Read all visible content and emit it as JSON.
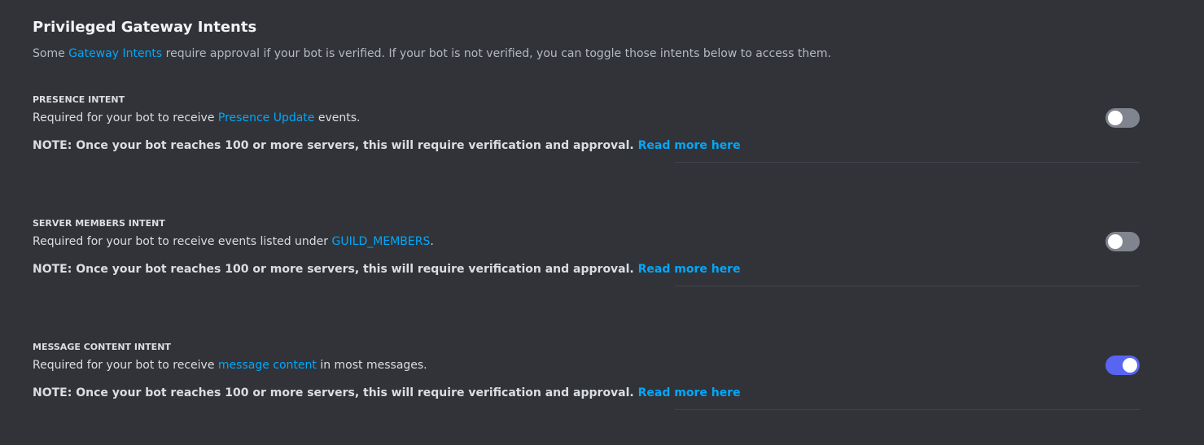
{
  "section": {
    "title": "Privileged Gateway Intents",
    "desc_pre": "Some ",
    "desc_link": "Gateway Intents",
    "desc_post": " require approval if your bot is verified. If your bot is not verified, you can toggle those intents below to access them."
  },
  "intents": [
    {
      "label": "PRESENCE INTENT",
      "desc_pre": "Required for your bot to receive ",
      "desc_link": "Presence Update",
      "desc_post": " events.",
      "note": "NOTE: Once your bot reaches 100 or more servers, this will require verification and approval.",
      "note_link": "Read more here",
      "enabled": false
    },
    {
      "label": "SERVER MEMBERS INTENT",
      "desc_pre": "Required for your bot to receive events listed under ",
      "desc_link": "GUILD_MEMBERS",
      "desc_post": ".",
      "note": "NOTE: Once your bot reaches 100 or more servers, this will require verification and approval.",
      "note_link": "Read more here",
      "enabled": false
    },
    {
      "label": "MESSAGE CONTENT INTENT",
      "desc_pre": "Required for your bot to receive ",
      "desc_link": "message content",
      "desc_post": " in most messages.",
      "note": "NOTE: Once your bot reaches 100 or more servers, this will require verification and approval.",
      "note_link": "Read more here",
      "enabled": true
    }
  ],
  "colors": {
    "background": "#313338",
    "link": "#00a8fc",
    "toggle_on": "#5865f2",
    "toggle_off": "#80848e"
  }
}
